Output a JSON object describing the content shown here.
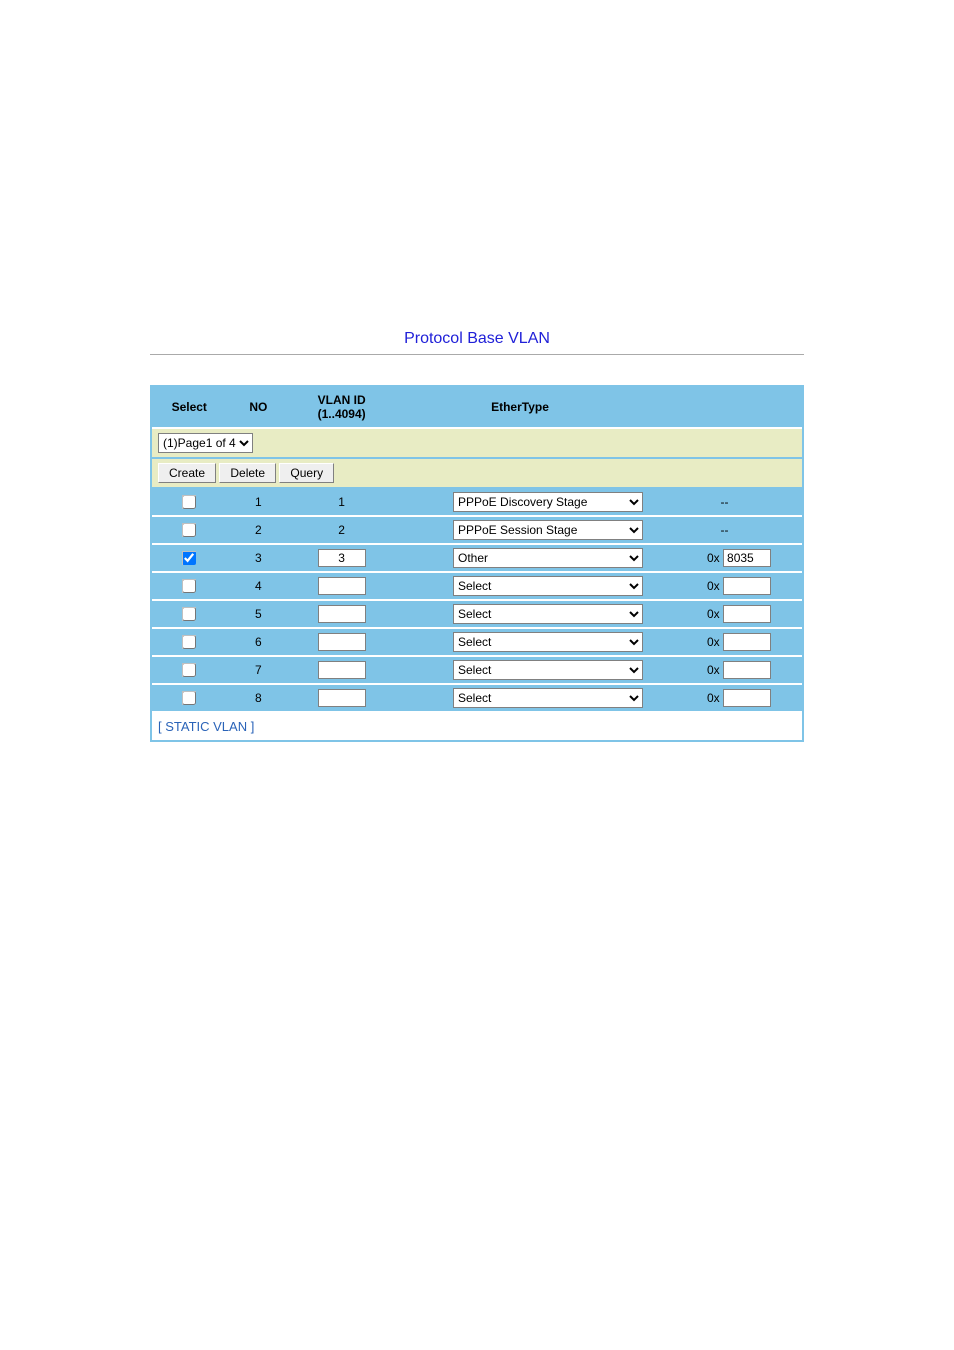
{
  "title": "Protocol Base VLAN",
  "page_selector": {
    "selected": "(1)Page1 of 4"
  },
  "buttons": {
    "create": "Create",
    "delete": "Delete",
    "query": "Query"
  },
  "columns": {
    "select": "Select",
    "no": "NO",
    "vlan": "VLAN ID (1..4094)",
    "ether": "EtherType",
    "hex": ""
  },
  "ether_options": [
    "Select",
    "PPPoE Discovery Stage",
    "PPPoE Session Stage",
    "Other"
  ],
  "rows": [
    {
      "selected": false,
      "no": "1",
      "vlan": "1",
      "vlan_editable": false,
      "ether": "PPPoE Discovery Stage",
      "hex_prefix": "",
      "hex": "--",
      "hex_editable": false
    },
    {
      "selected": false,
      "no": "2",
      "vlan": "2",
      "vlan_editable": false,
      "ether": "PPPoE Session Stage",
      "hex_prefix": "",
      "hex": "--",
      "hex_editable": false
    },
    {
      "selected": true,
      "no": "3",
      "vlan": "3",
      "vlan_editable": true,
      "ether": "Other",
      "hex_prefix": "0x",
      "hex": "8035",
      "hex_editable": true
    },
    {
      "selected": false,
      "no": "4",
      "vlan": "",
      "vlan_editable": true,
      "ether": "Select",
      "hex_prefix": "0x",
      "hex": "",
      "hex_editable": true
    },
    {
      "selected": false,
      "no": "5",
      "vlan": "",
      "vlan_editable": true,
      "ether": "Select",
      "hex_prefix": "0x",
      "hex": "",
      "hex_editable": true
    },
    {
      "selected": false,
      "no": "6",
      "vlan": "",
      "vlan_editable": true,
      "ether": "Select",
      "hex_prefix": "0x",
      "hex": "",
      "hex_editable": true
    },
    {
      "selected": false,
      "no": "7",
      "vlan": "",
      "vlan_editable": true,
      "ether": "Select",
      "hex_prefix": "0x",
      "hex": "",
      "hex_editable": true
    },
    {
      "selected": false,
      "no": "8",
      "vlan": "",
      "vlan_editable": true,
      "ether": "Select",
      "hex_prefix": "0x",
      "hex": "",
      "hex_editable": true
    }
  ],
  "footer": {
    "prefix": "[ ",
    "link": "STATIC VLAN",
    "suffix": " ]"
  }
}
